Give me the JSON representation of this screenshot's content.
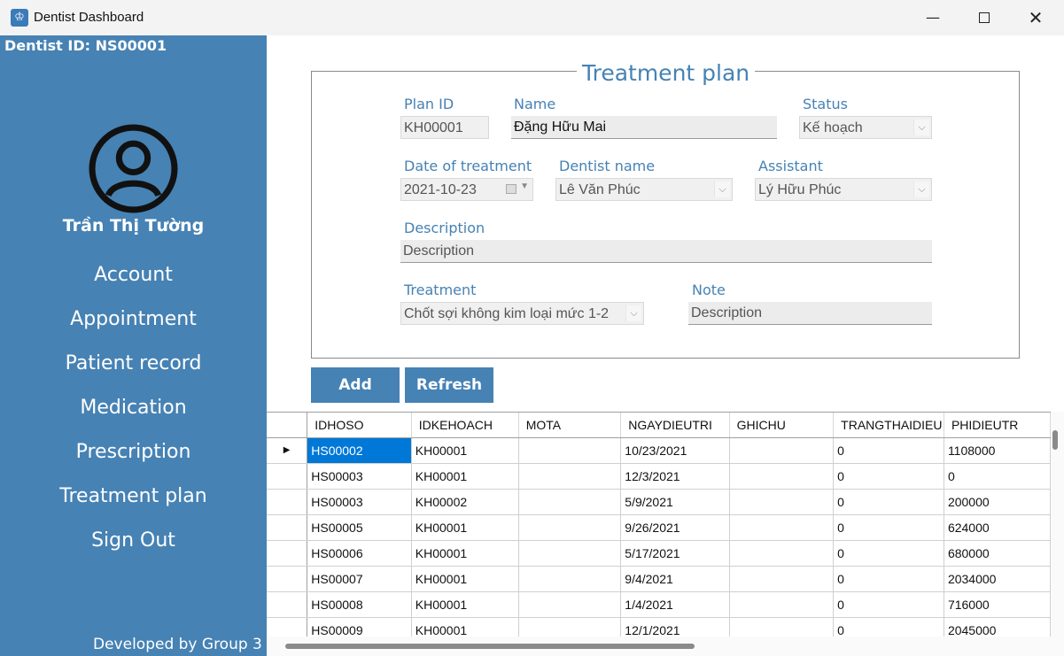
{
  "window": {
    "title": "Dentist Dashboard",
    "minimize": "—",
    "close": "✕"
  },
  "sidebar": {
    "dentist_id": "Dentist ID: NS00001",
    "user_name": "Trần Thị Tường",
    "nav": [
      "Account",
      "Appointment",
      "Patient record",
      "Medication",
      "Prescription",
      "Treatment plan",
      "Sign Out"
    ],
    "footer": "Developed by Group 3"
  },
  "form": {
    "title": "Treatment plan",
    "plan_id": {
      "label": "Plan ID",
      "value": "KH00001"
    },
    "name": {
      "label": "Name",
      "value": "Đặng Hữu Mai"
    },
    "status": {
      "label": "Status",
      "value": "Kế hoạch"
    },
    "date": {
      "label": "Date of treatment",
      "value": "2021-10-23"
    },
    "dentist": {
      "label": "Dentist name",
      "value": "Lê Văn Phúc"
    },
    "assistant": {
      "label": "Assistant",
      "value": "Lý Hữu Phúc"
    },
    "description": {
      "label": "Description",
      "value": "Description"
    },
    "treatment": {
      "label": "Treatment",
      "value": "Chốt sợi không kim loại mức 1-2"
    },
    "note": {
      "label": "Note",
      "value": "Description"
    }
  },
  "buttons": {
    "add": "Add",
    "refresh": "Refresh"
  },
  "grid": {
    "columns": [
      "IDHOSO",
      "IDKEHOACH",
      "MOTA",
      "NGAYDIEUTRI",
      "GHICHU",
      "TRANGTHAIDIEU",
      "PHIDIEUTR"
    ],
    "current_marker": "▶",
    "rows": [
      [
        "HS00002",
        "KH00001",
        "",
        "10/23/2021",
        "",
        "0",
        "1108000"
      ],
      [
        "HS00003",
        "KH00001",
        "",
        "12/3/2021",
        "",
        "0",
        "0"
      ],
      [
        "HS00003",
        "KH00002",
        "",
        "5/9/2021",
        "",
        "0",
        "200000"
      ],
      [
        "HS00005",
        "KH00001",
        "",
        "9/26/2021",
        "",
        "0",
        "624000"
      ],
      [
        "HS00006",
        "KH00001",
        "",
        "5/17/2021",
        "",
        "0",
        "680000"
      ],
      [
        "HS00007",
        "KH00001",
        "",
        "9/4/2021",
        "",
        "0",
        "2034000"
      ],
      [
        "HS00008",
        "KH00001",
        "",
        "1/4/2021",
        "",
        "0",
        "716000"
      ],
      [
        "HS00009",
        "KH00001",
        "",
        "12/1/2021",
        "",
        "0",
        "2045000"
      ]
    ]
  },
  "colors": {
    "accent": "#4682b4",
    "selection": "#0078d7"
  }
}
